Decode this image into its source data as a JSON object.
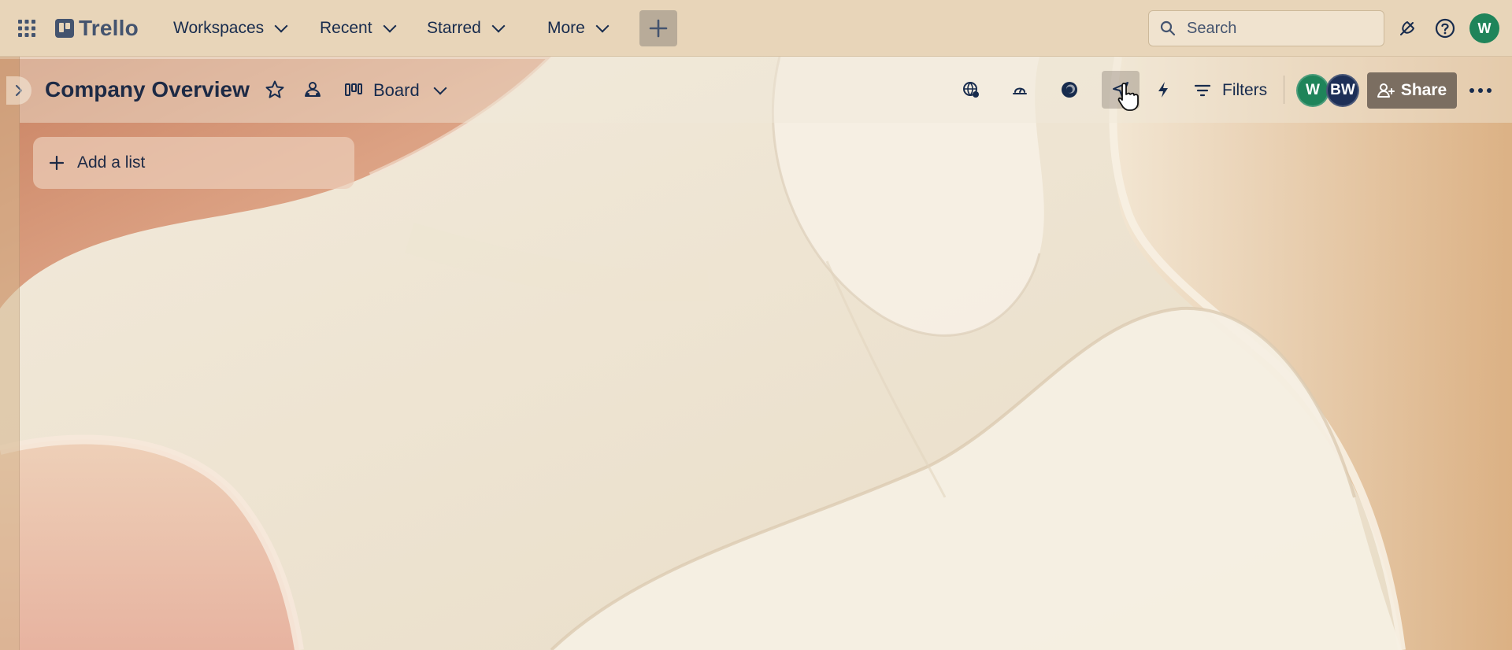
{
  "topbar": {
    "logo": "Trello",
    "nav": [
      {
        "label": "Workspaces"
      },
      {
        "label": "Recent"
      },
      {
        "label": "Starred"
      },
      {
        "label": "More"
      }
    ],
    "search_placeholder": "Search",
    "avatar_initial": "W"
  },
  "board": {
    "title": "Company Overview",
    "view_label": "Board",
    "filters_label": "Filters",
    "members": [
      {
        "initials": "W",
        "color": "#1f845a"
      },
      {
        "initials": "BW",
        "color": "#1d2f57"
      }
    ],
    "share_label": "Share"
  },
  "lists": {
    "add_list_label": "Add a list"
  },
  "colors": {
    "topbar_bg": "#e8d5b9",
    "share_bg": "#7b6e61",
    "avatar_green": "#1f845a"
  }
}
